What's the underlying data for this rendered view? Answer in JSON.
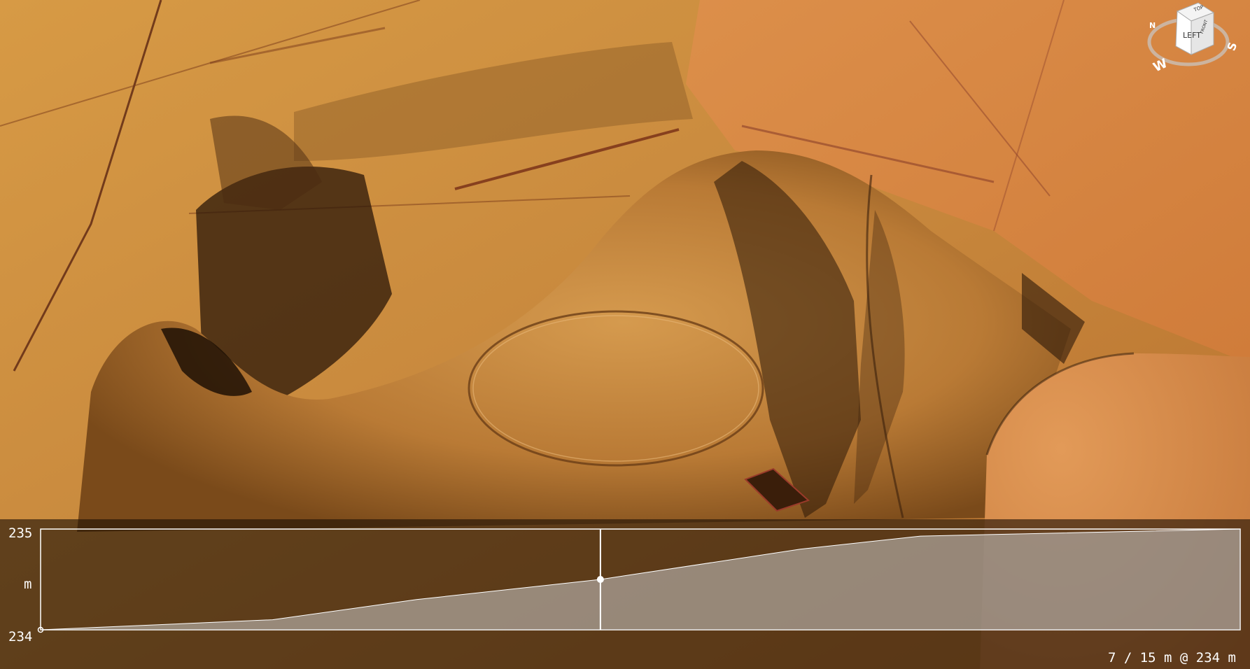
{
  "view_cube": {
    "faces": {
      "front": "LEFT",
      "top": "TOP",
      "side": "FRONT"
    },
    "compass": {
      "west": "W",
      "south": "S",
      "north": "N"
    }
  },
  "profile": {
    "y_max_label": "235",
    "y_unit_label": "m",
    "y_min_label": "234",
    "status": "7 / 15 m @ 234 m",
    "ylim": [
      234,
      235
    ],
    "x_range": [
      0,
      15
    ],
    "cursor_x": 7,
    "cursor_y": 234.5,
    "elevation_profile": [
      [
        0,
        234.0
      ],
      [
        2.9,
        234.1
      ],
      [
        4.7,
        234.3
      ],
      [
        7.0,
        234.5
      ],
      [
        9.5,
        234.8
      ],
      [
        11.0,
        234.93
      ],
      [
        15.0,
        235.0
      ]
    ]
  },
  "colors": {
    "profile_fill": "#c8c8c8",
    "profile_line": "#ffffff",
    "cursor": "#ffffff"
  }
}
